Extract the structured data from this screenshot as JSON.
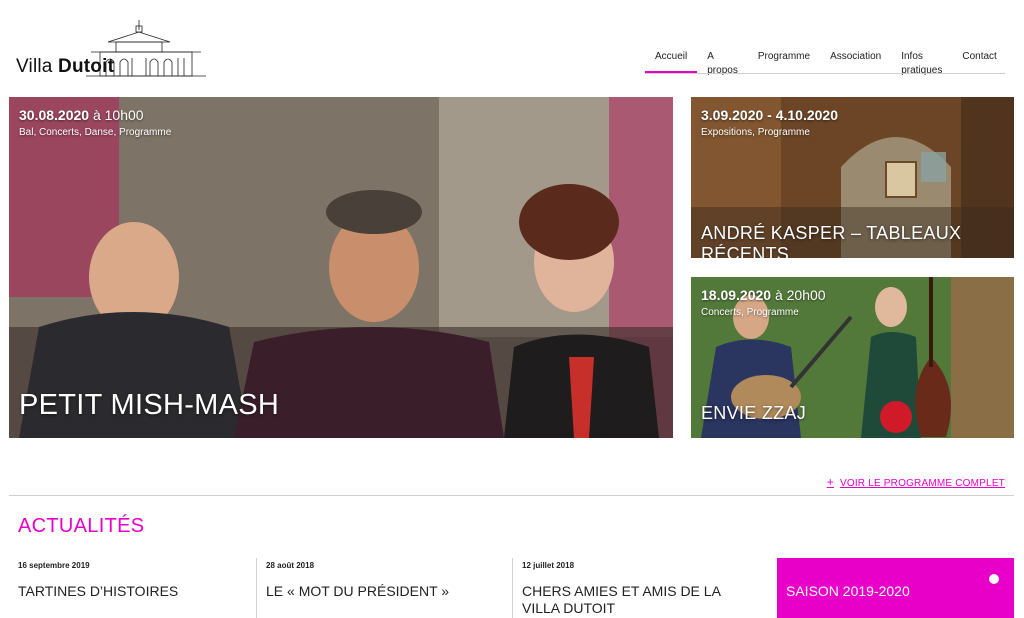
{
  "brand": {
    "name_regular": "Villa ",
    "name_bold": "Dutoit"
  },
  "nav": {
    "items": [
      "Accueil",
      "A propos",
      "Programme",
      "Association",
      "Infos pratiques",
      "Contact"
    ],
    "active": "Accueil"
  },
  "tiles": {
    "main": {
      "date": "30.08.2020",
      "time": " à 10h00",
      "categories": "Bal, Concerts, Danse, Programme",
      "title": "PETIT MISH-MASH"
    },
    "kasper": {
      "date": "3.09.2020 - 4.10.2020",
      "time": "",
      "categories": "Expositions, Programme",
      "title": "ANDRÉ KASPER – TABLEAUX RÉCENTS"
    },
    "zzaj": {
      "date": "18.09.2020",
      "time": " à 20h00",
      "categories": "Concerts, Programme",
      "title": "ENVIE ZZAJ"
    }
  },
  "program_link": "VOIR LE PROGRAMME COMPLET",
  "news": {
    "heading": "ACTUALITÉS",
    "items": [
      {
        "date": "16 septembre 2019",
        "title": "TARTINES D’HISTOIRES"
      },
      {
        "date": "28 août 2018",
        "title": "LE « MOT DU PRÉSIDENT »"
      },
      {
        "date": "12 juillet 2018",
        "title": "CHERS AMIES ET AMIS DE LA VILLA DUTOIT"
      }
    ],
    "season": "SAISON 2019-2020"
  },
  "colors": {
    "accent": "#e800c8"
  },
  "icons": {
    "plus": "plus-icon",
    "dot": "dot-icon",
    "logo_drawing": "villa-building-icon"
  }
}
